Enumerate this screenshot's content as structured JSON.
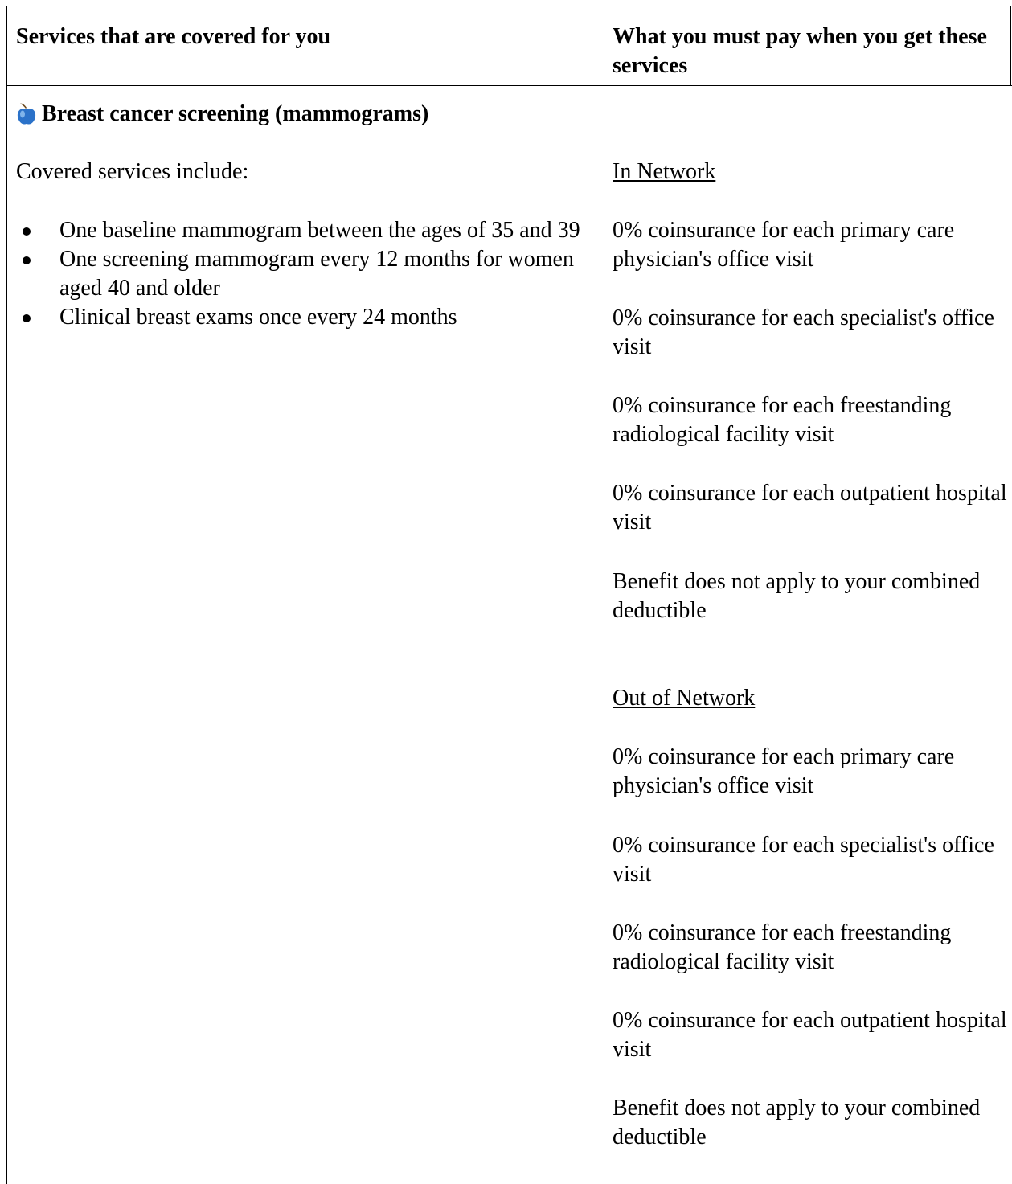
{
  "header": {
    "left": "Services that are covered for you",
    "right": "What you must pay when you get these services"
  },
  "service": {
    "icon": "apple-icon",
    "title": "Breast cancer screening (mammograms)",
    "intro": "Covered services include:",
    "bullets": [
      "One baseline mammogram between the ages of 35 and 39",
      "One screening mammogram every 12 months for women aged 40 and older",
      "Clinical breast exams once every 24 months"
    ]
  },
  "in_network": {
    "heading": "In Network",
    "lines": [
      "0% coinsurance for each primary care physician's office visit",
      "0% coinsurance for each specialist's office visit",
      "0% coinsurance for each freestanding radiological facility visit",
      "0% coinsurance for each outpatient hospital visit",
      "Benefit does not apply to your combined deductible"
    ]
  },
  "out_of_network": {
    "heading": "Out of Network",
    "lines": [
      "0% coinsurance for each primary care physician's office visit",
      "0% coinsurance for each specialist's office visit",
      "0% coinsurance for each freestanding radiological facility visit",
      "0% coinsurance for each outpatient hospital visit",
      "Benefit does not apply to your combined deductible"
    ]
  },
  "colors": {
    "apple": "#2b72c9",
    "apple_highlight": "#8fc0f0",
    "stem": "#6b4a1f",
    "text": "#000000"
  }
}
